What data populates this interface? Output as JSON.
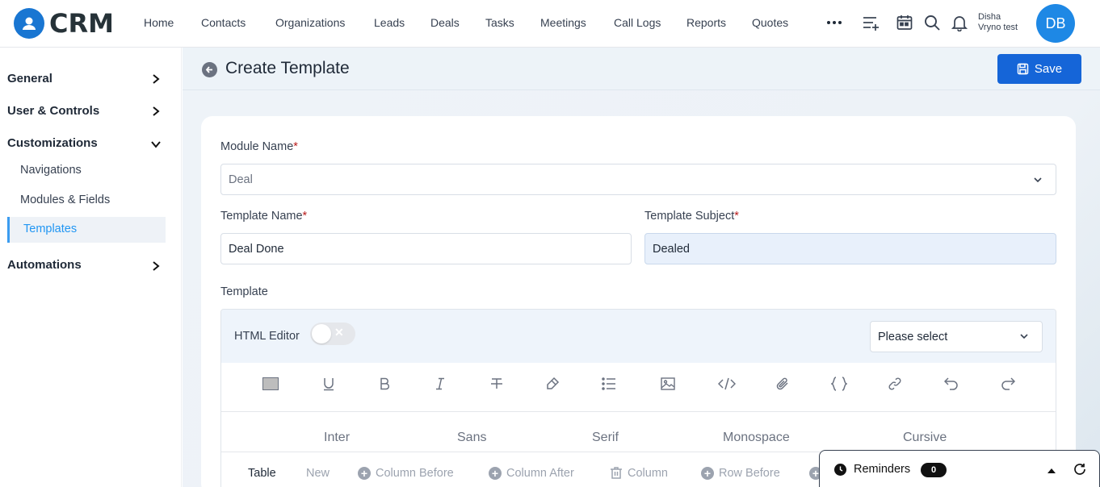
{
  "app": {
    "name": "CRM",
    "brand_color": "#1976d2"
  },
  "nav": {
    "links": [
      "Home",
      "Contacts",
      "Organizations",
      "Leads",
      "Deals",
      "Tasks",
      "Meetings",
      "Call Logs",
      "Reports",
      "Quotes"
    ],
    "icons": [
      "more-icon",
      "add-list-icon",
      "calendar-icon",
      "search-icon",
      "bell-icon"
    ]
  },
  "user": {
    "first_name": "Disha",
    "last_name": "Vryno test",
    "initials": "DB"
  },
  "sidebar": {
    "general": "General",
    "user_controls": "User & Controls",
    "customizations": "Customizations",
    "sub_items": [
      "Navigations",
      "Modules & Fields",
      "Templates"
    ],
    "active": "Templates",
    "automations": "Automations"
  },
  "page": {
    "title": "Create Template",
    "save_label": "Save"
  },
  "form": {
    "module_label": "Module Name",
    "module_value": "Deal",
    "template_name_label": "Template Name",
    "template_name_value": "Deal Done",
    "template_subject_label": "Template Subject",
    "template_subject_value": "Dealed",
    "template_label": "Template",
    "required_mark": "*"
  },
  "editor": {
    "html_editor_label": "HTML Editor",
    "html_editor_on": false,
    "select_placeholder": "Please select",
    "toolbar_icons": [
      "color-swatch-icon",
      "underline-icon",
      "bold-icon",
      "italic-icon",
      "strikethrough-icon",
      "highlighter-icon",
      "list-icon",
      "image-icon",
      "code-icon",
      "attachment-icon",
      "braces-icon",
      "link-icon",
      "undo-icon",
      "redo-icon"
    ],
    "fonts": [
      "Inter",
      "Sans",
      "Serif",
      "Monospace",
      "Cursive"
    ],
    "table_tools": [
      "Table",
      "New",
      "Column Before",
      "Column After",
      "Column",
      "Row Before"
    ]
  },
  "reminders": {
    "label": "Reminders",
    "count": "0"
  }
}
